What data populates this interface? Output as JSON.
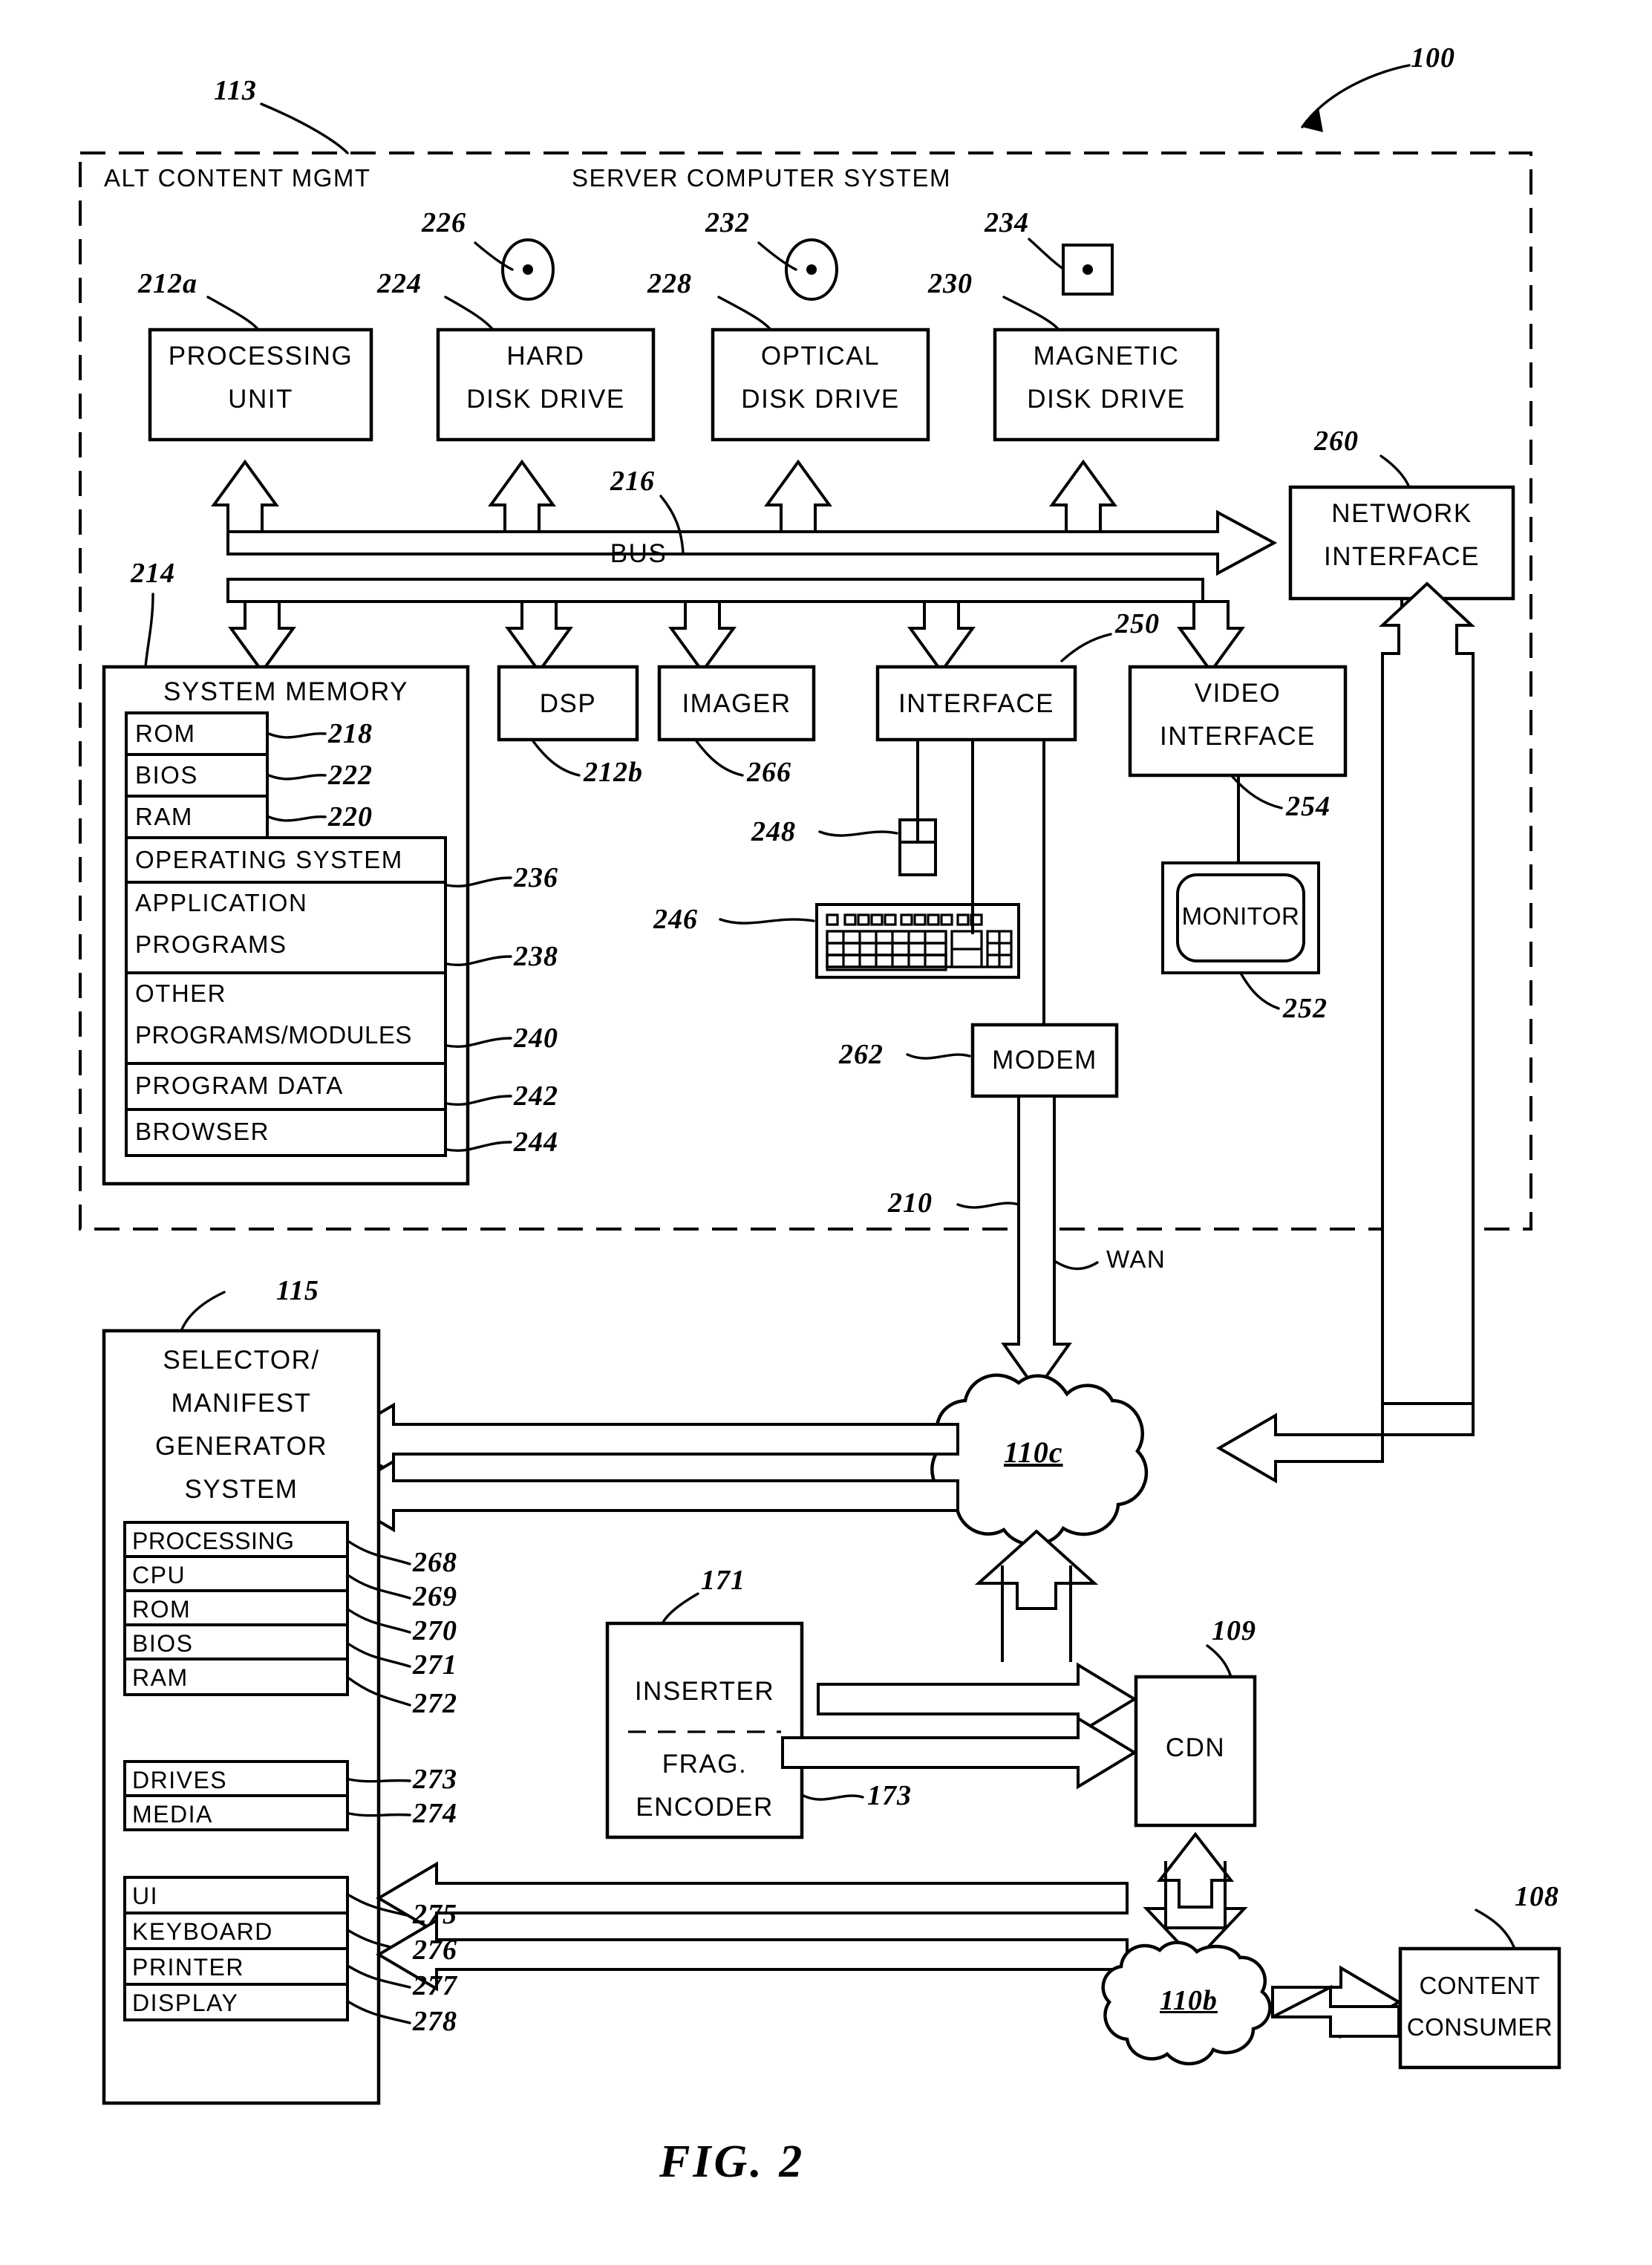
{
  "figure": {
    "caption": "FIG. 2",
    "system_ref": "100"
  },
  "server_system": {
    "ref": "113",
    "title_left": "ALT CONTENT MGMT",
    "title_right": "SERVER COMPUTER SYSTEM",
    "boxes": {
      "processing_unit": {
        "label_line1": "PROCESSING",
        "label_line2": "UNIT",
        "ref": "212a"
      },
      "hard_disk_drive": {
        "label_line1": "HARD",
        "label_line2": "DISK  DRIVE",
        "ref": "224",
        "media_ref": "226"
      },
      "optical_disk_drive": {
        "label_line1": "OPTICAL",
        "label_line2": "DISK  DRIVE",
        "ref": "228",
        "media_ref": "232"
      },
      "magnetic_disk_drive": {
        "label_line1": "MAGNETIC",
        "label_line2": "DISK  DRIVE",
        "ref": "230",
        "media_ref": "234"
      },
      "network_interface": {
        "label_line1": "NETWORK",
        "label_line2": "INTERFACE",
        "ref": "260"
      },
      "bus": {
        "label": "BUS",
        "ref": "216"
      },
      "dsp": {
        "label": "DSP",
        "ref": "212b"
      },
      "imager": {
        "label": "IMAGER",
        "ref": "266"
      },
      "interface": {
        "label": "INTERFACE",
        "ref": "250"
      },
      "video_interface": {
        "label_line1": "VIDEO",
        "label_line2": "INTERFACE",
        "ref": "254"
      },
      "monitor": {
        "label": "MONITOR",
        "ref": "252"
      },
      "modem": {
        "label": "MODEM",
        "ref": "262"
      },
      "mouse": {
        "ref": "248"
      },
      "keyboard": {
        "ref": "246"
      },
      "wan": {
        "label": "WAN",
        "ref": "210"
      }
    },
    "system_memory": {
      "title": "SYSTEM  MEMORY",
      "ref": "214",
      "rows": [
        {
          "label": "ROM",
          "ref": "218"
        },
        {
          "label": "BIOS",
          "ref": "222"
        },
        {
          "label": "RAM",
          "ref": "220"
        },
        {
          "label": "OPERATING  SYSTEM",
          "ref": "236"
        },
        {
          "label_line1": "APPLICATION",
          "label_line2": "PROGRAMS",
          "ref": "238"
        },
        {
          "label_line1": "OTHER",
          "label_line2": "PROGRAMS/MODULES",
          "ref": "240"
        },
        {
          "label": "PROGRAM  DATA",
          "ref": "242"
        },
        {
          "label": "BROWSER",
          "ref": "244"
        }
      ]
    }
  },
  "selector_system": {
    "ref": "115",
    "title_lines": [
      "SELECTOR/",
      "MANIFEST",
      "GENERATOR",
      "SYSTEM"
    ],
    "group_processing": [
      {
        "label": "PROCESSING",
        "ref": "268"
      },
      {
        "label": "CPU",
        "ref": "269"
      },
      {
        "label": "ROM",
        "ref": "270"
      },
      {
        "label": "BIOS",
        "ref": "271"
      },
      {
        "label": "RAM",
        "ref": "272"
      }
    ],
    "group_drives": [
      {
        "label": "DRIVES",
        "ref": "273"
      },
      {
        "label": "MEDIA",
        "ref": "274"
      }
    ],
    "group_ui": [
      {
        "label": "UI",
        "ref": "275"
      },
      {
        "label": "KEYBOARD",
        "ref": "276"
      },
      {
        "label": "PRINTER",
        "ref": "277"
      },
      {
        "label": "DISPLAY",
        "ref": "278"
      }
    ]
  },
  "network": {
    "cloud_upper": "110c",
    "cloud_lower": "110b"
  },
  "nodes": {
    "inserter": {
      "label": "INSERTER",
      "ref": "171"
    },
    "frag_encoder": {
      "label_line1": "FRAG.",
      "label_line2": "ENCODER",
      "ref": "173"
    },
    "cdn": {
      "label": "CDN",
      "ref": "109"
    },
    "content_consumer": {
      "label_line1": "CONTENT",
      "label_line2": "CONSUMER",
      "ref": "108"
    }
  },
  "style": {
    "stroke": "#000000",
    "fill": "#ffffff"
  }
}
